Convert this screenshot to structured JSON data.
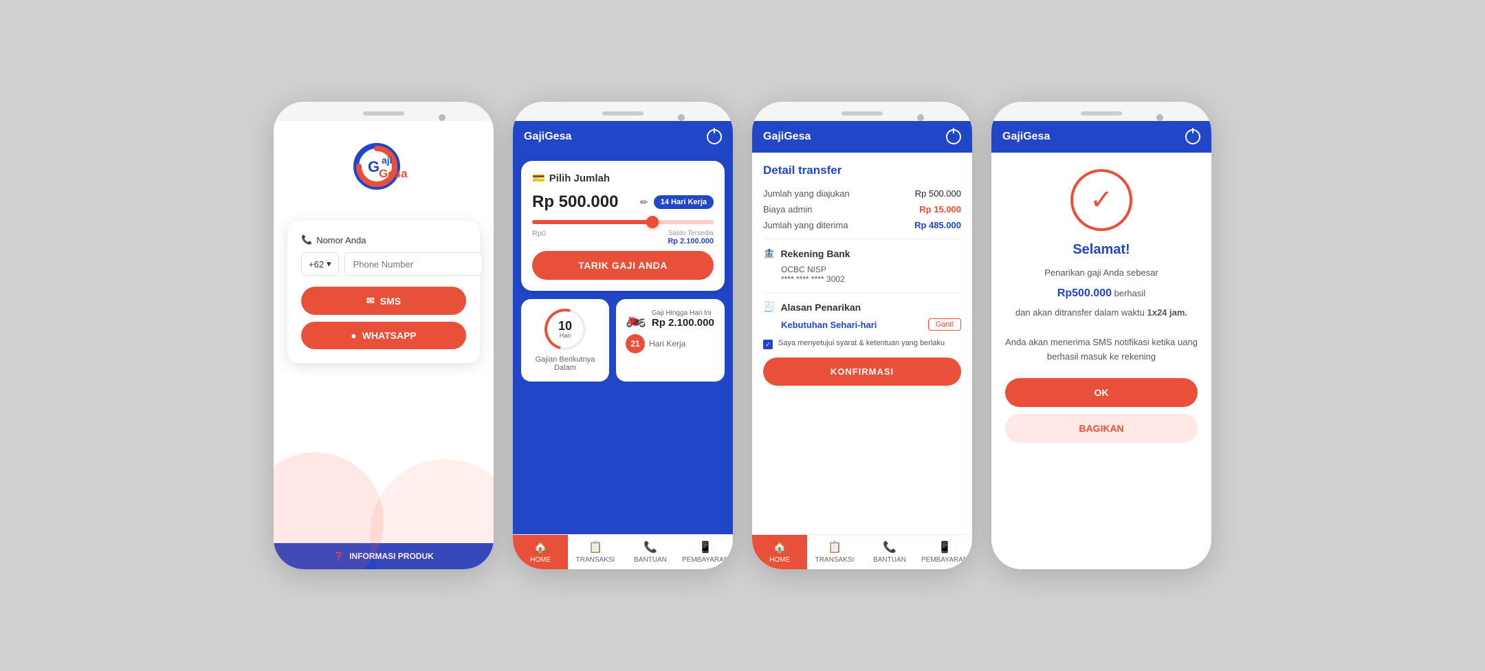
{
  "phone1": {
    "logo_text": "Gaji Gesa",
    "nomor_label": "Nomor Anda",
    "country_code": "+62",
    "phone_placeholder": "Phone Number",
    "sms_label": "SMS",
    "whatsapp_label": "WHATSAPP",
    "footer_label": "INFORMASI PRODUK"
  },
  "phone2": {
    "app_name": "GajiGesa",
    "card_title": "Pilih Jumlah",
    "amount": "Rp 500.000",
    "hari_kerja_badge": "14 Hari Kerja",
    "slider_min": "Rp0",
    "slider_max_label": "Saldo Tersedia",
    "slider_max": "Rp 2.100.000",
    "btn_tarik": "TARIK GAJI ANDA",
    "days_number": "10",
    "days_unit": "Hari",
    "panel_days_text": "Gajian Berikutnya Dalam",
    "gaji_subtitle": "Gaji Hingga Hari Ini",
    "gaji_amount": "Rp 2.100.000",
    "hari_kerja_number": "21",
    "hari_kerja_text": "Hari Kerja",
    "nav": [
      {
        "label": "HOME",
        "icon": "🏠",
        "active": true
      },
      {
        "label": "TRANSAKSI",
        "icon": "📋",
        "active": false
      },
      {
        "label": "BANTUAN",
        "icon": "📞",
        "active": false
      },
      {
        "label": "PEMBAYARAN",
        "icon": "📱",
        "active": false
      }
    ]
  },
  "phone3": {
    "app_name": "GajiGesa",
    "card_title": "Detail transfer",
    "jumlah_diajukan_label": "Jumlah yang diajukan",
    "jumlah_diajukan_value": "Rp 500.000",
    "biaya_admin_label": "Biaya admin",
    "biaya_admin_value": "Rp 15.000",
    "jumlah_diterima_label": "Jumlah yang diterima",
    "jumlah_diterima_value": "Rp 485.000",
    "rekening_bank_label": "Rekening Bank",
    "bank_name": "OCBC NISP",
    "bank_account": "**** **** **** 3002",
    "alasan_label": "Alasan Penarikan",
    "alasan_value": "Kebutuhan Sehari-hari",
    "ganti_btn": "Ganti",
    "checkbox_text": "Saya menyetujui syarat & ketentuan yang berlaku",
    "btn_konfirmasi": "KONFIRMASI",
    "nav": [
      {
        "label": "HOME",
        "icon": "🏠",
        "active": true
      },
      {
        "label": "TRANSAKSI",
        "icon": "📋",
        "active": false
      },
      {
        "label": "BANTUAN",
        "icon": "📞",
        "active": false
      },
      {
        "label": "PEMBAYARAN",
        "icon": "📱",
        "active": false
      }
    ]
  },
  "phone4": {
    "app_name": "GajiGesa",
    "selamat_title": "Selamat!",
    "desc1": "Penarikan gaji Anda sebesar",
    "amount": "Rp500.000",
    "desc2": "berhasil",
    "desc3": "dan akan ditransfer dalam waktu",
    "duration": "1x24 jam.",
    "desc4": "Anda akan menerima SMS notifikasi ketika uang berhasil masuk ke rekening",
    "btn_ok": "OK",
    "btn_bagikan": "BAGIKAN"
  }
}
